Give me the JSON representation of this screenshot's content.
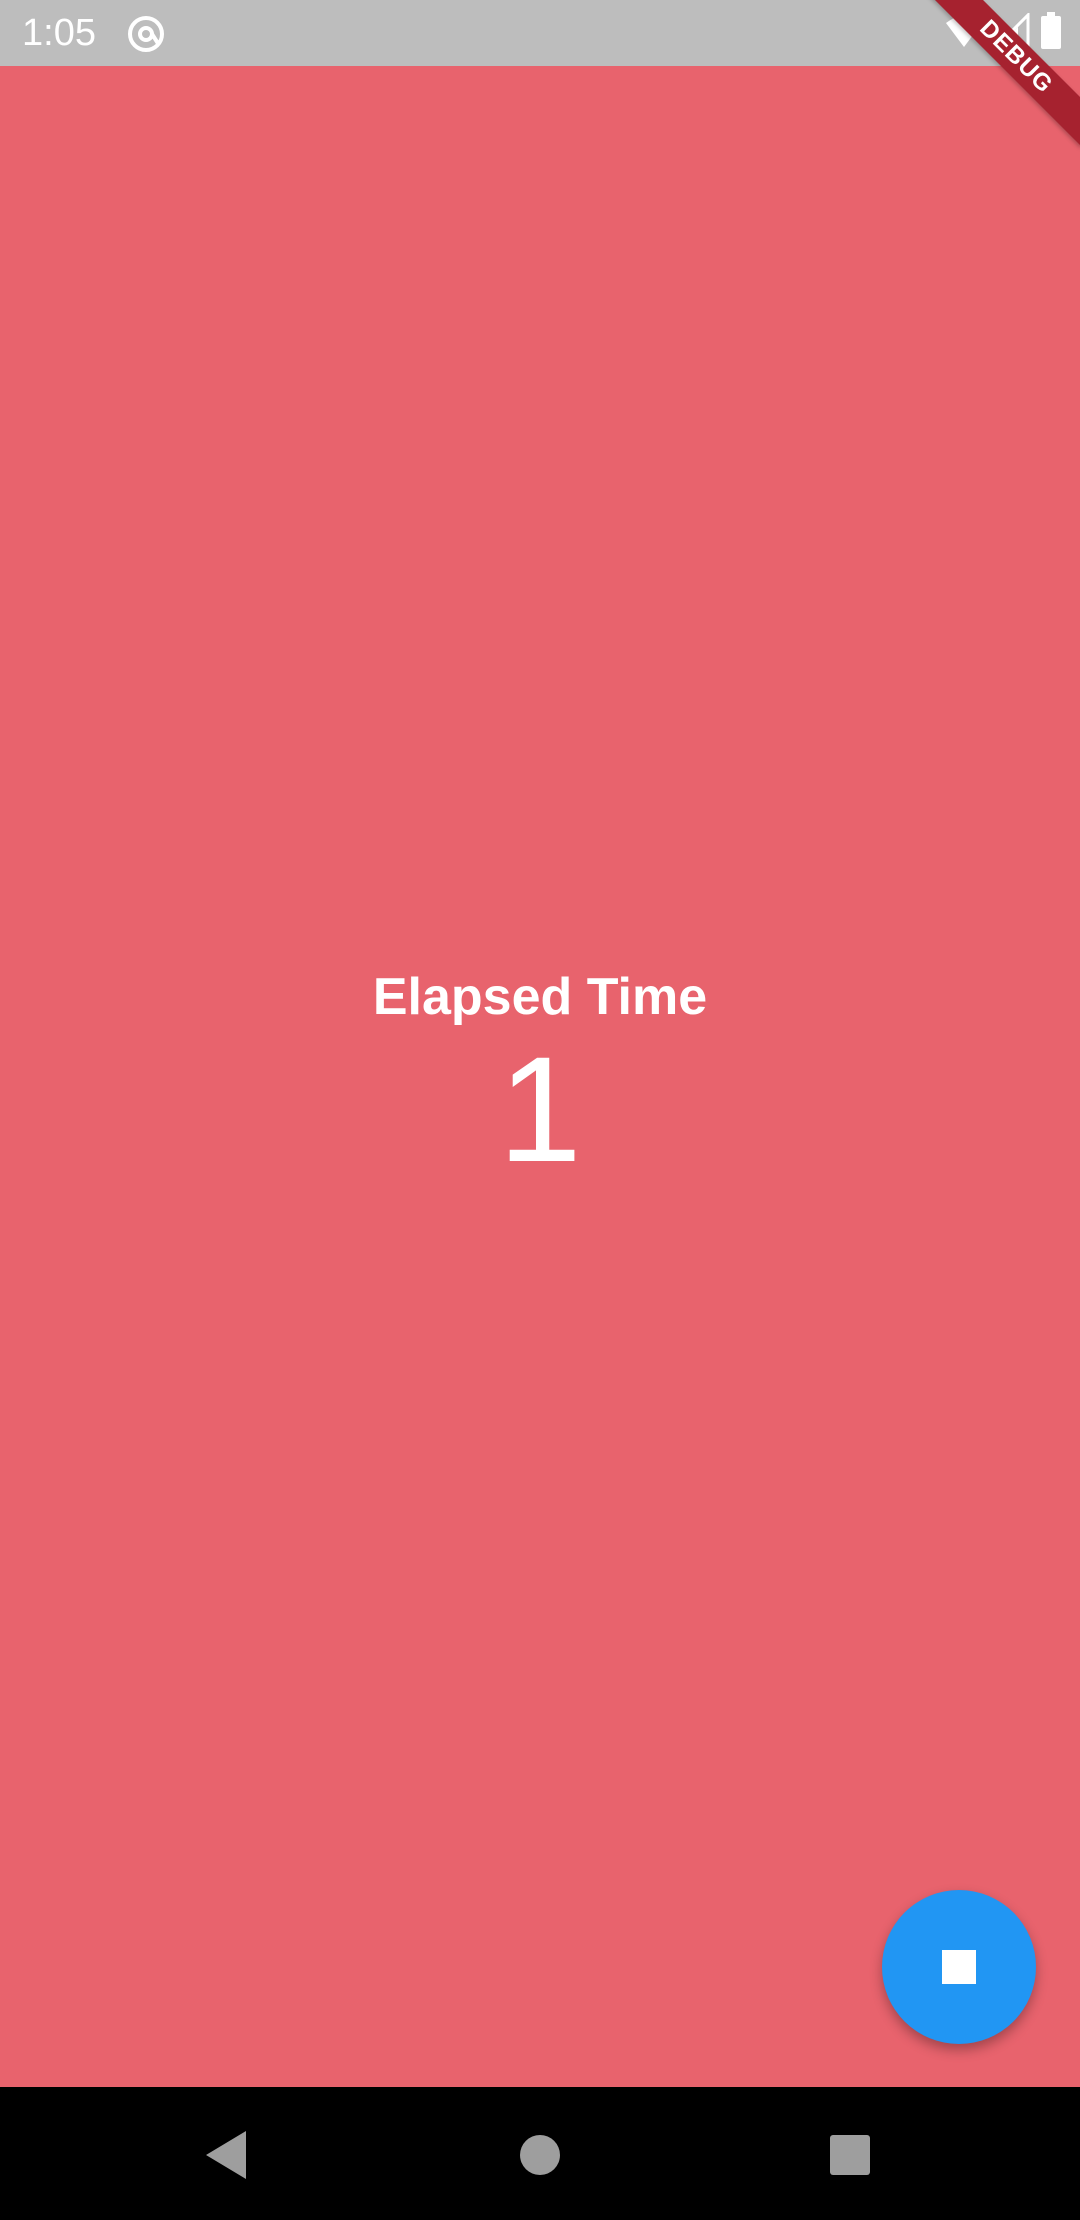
{
  "status_bar": {
    "time": "1:05",
    "app_icon": "at-sign-icon",
    "wifi_icon": "wifi-icon",
    "signal_icon": "cellular-signal-icon",
    "battery_icon": "battery-icon"
  },
  "debug_banner": {
    "label": "DEBUG"
  },
  "timer": {
    "label": "Elapsed Time",
    "value": "1"
  },
  "fab": {
    "icon": "stop-icon",
    "color": "#2196f3"
  },
  "nav": {
    "back_icon": "back-triangle-icon",
    "home_icon": "home-circle-icon",
    "recents_icon": "recents-square-icon"
  },
  "colors": {
    "background": "#e8636d",
    "status_bar": "#bdbdbd",
    "debug_ribbon": "#a6222f"
  }
}
